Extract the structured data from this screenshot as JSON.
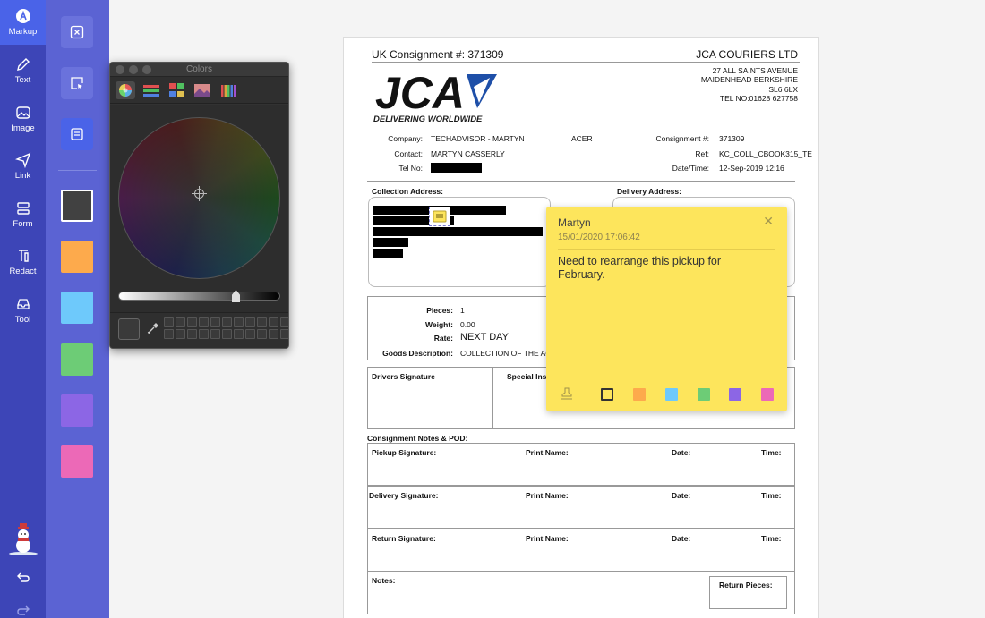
{
  "rail": {
    "items": [
      {
        "label": "Markup"
      },
      {
        "label": "Text"
      },
      {
        "label": "Image"
      },
      {
        "label": "Link"
      },
      {
        "label": "Form"
      },
      {
        "label": "Redact"
      },
      {
        "label": "Tool"
      }
    ]
  },
  "palette": {
    "swatches": [
      "#414141",
      "#fdaa4c",
      "#6ec9fb",
      "#6dcc76",
      "#8c66e5",
      "#ec69b7"
    ]
  },
  "colors_panel": {
    "title": "Colors"
  },
  "document": {
    "consignment_label": "UK Consignment #: 371309",
    "company_name": "JCA COURIERS LTD",
    "address": [
      "27 ALL SAINTS AVENUE",
      "MAIDENHEAD BERKSHIRE",
      "SL6 6LX",
      "TEL NO:01628 627758"
    ],
    "logo_text": "JCA",
    "logo_tagline": "DELIVERING WORLDWIDE",
    "company_label": "Company:",
    "company_value": "TECHADVISOR - MARTYN",
    "company_extra": "ACER",
    "contact_label": "Contact:",
    "contact_value": "MARTYN CASSERLY",
    "tel_label": "Tel No:",
    "cons_no_label": "Consignment #:",
    "cons_no_value": "371309",
    "ref_label": "Ref:",
    "ref_value": "KC_COLL_CBOOK315_TE",
    "datetime_label": "Date/Time:",
    "datetime_value": "12-Sep-2019 12:16",
    "collection_label": "Collection Address:",
    "delivery_label": "Delivery Address:",
    "pieces_label": "Pieces:",
    "pieces_value": "1",
    "weight_label": "Weight:",
    "weight_value": "0.00",
    "rate_label": "Rate:",
    "rate_value": "NEXT DAY",
    "goods_label": "Goods Description:",
    "goods_value": "COLLECTION OF THE AC",
    "drivers_sig": "Drivers Signature",
    "special_ins": "Special Ins",
    "cons_notes": "Consignment Notes & POD:",
    "pickup_sig": "Pickup Signature:",
    "delivery_sig": "Delivery Signature:",
    "return_sig": "Return Signature:",
    "print_name": "Print Name:",
    "date": "Date:",
    "time": "Time:",
    "notes": "Notes:",
    "return_pieces": "Return Pieces:"
  },
  "note": {
    "author": "Martyn",
    "timestamp": "15/01/2020 17:06:42",
    "text": "Need to rearrange this pickup for\nFebruary.",
    "colors": [
      "#fdaa4c",
      "#6ec9fb",
      "#6dcc76",
      "#8c66e5",
      "#ec69b7"
    ]
  }
}
